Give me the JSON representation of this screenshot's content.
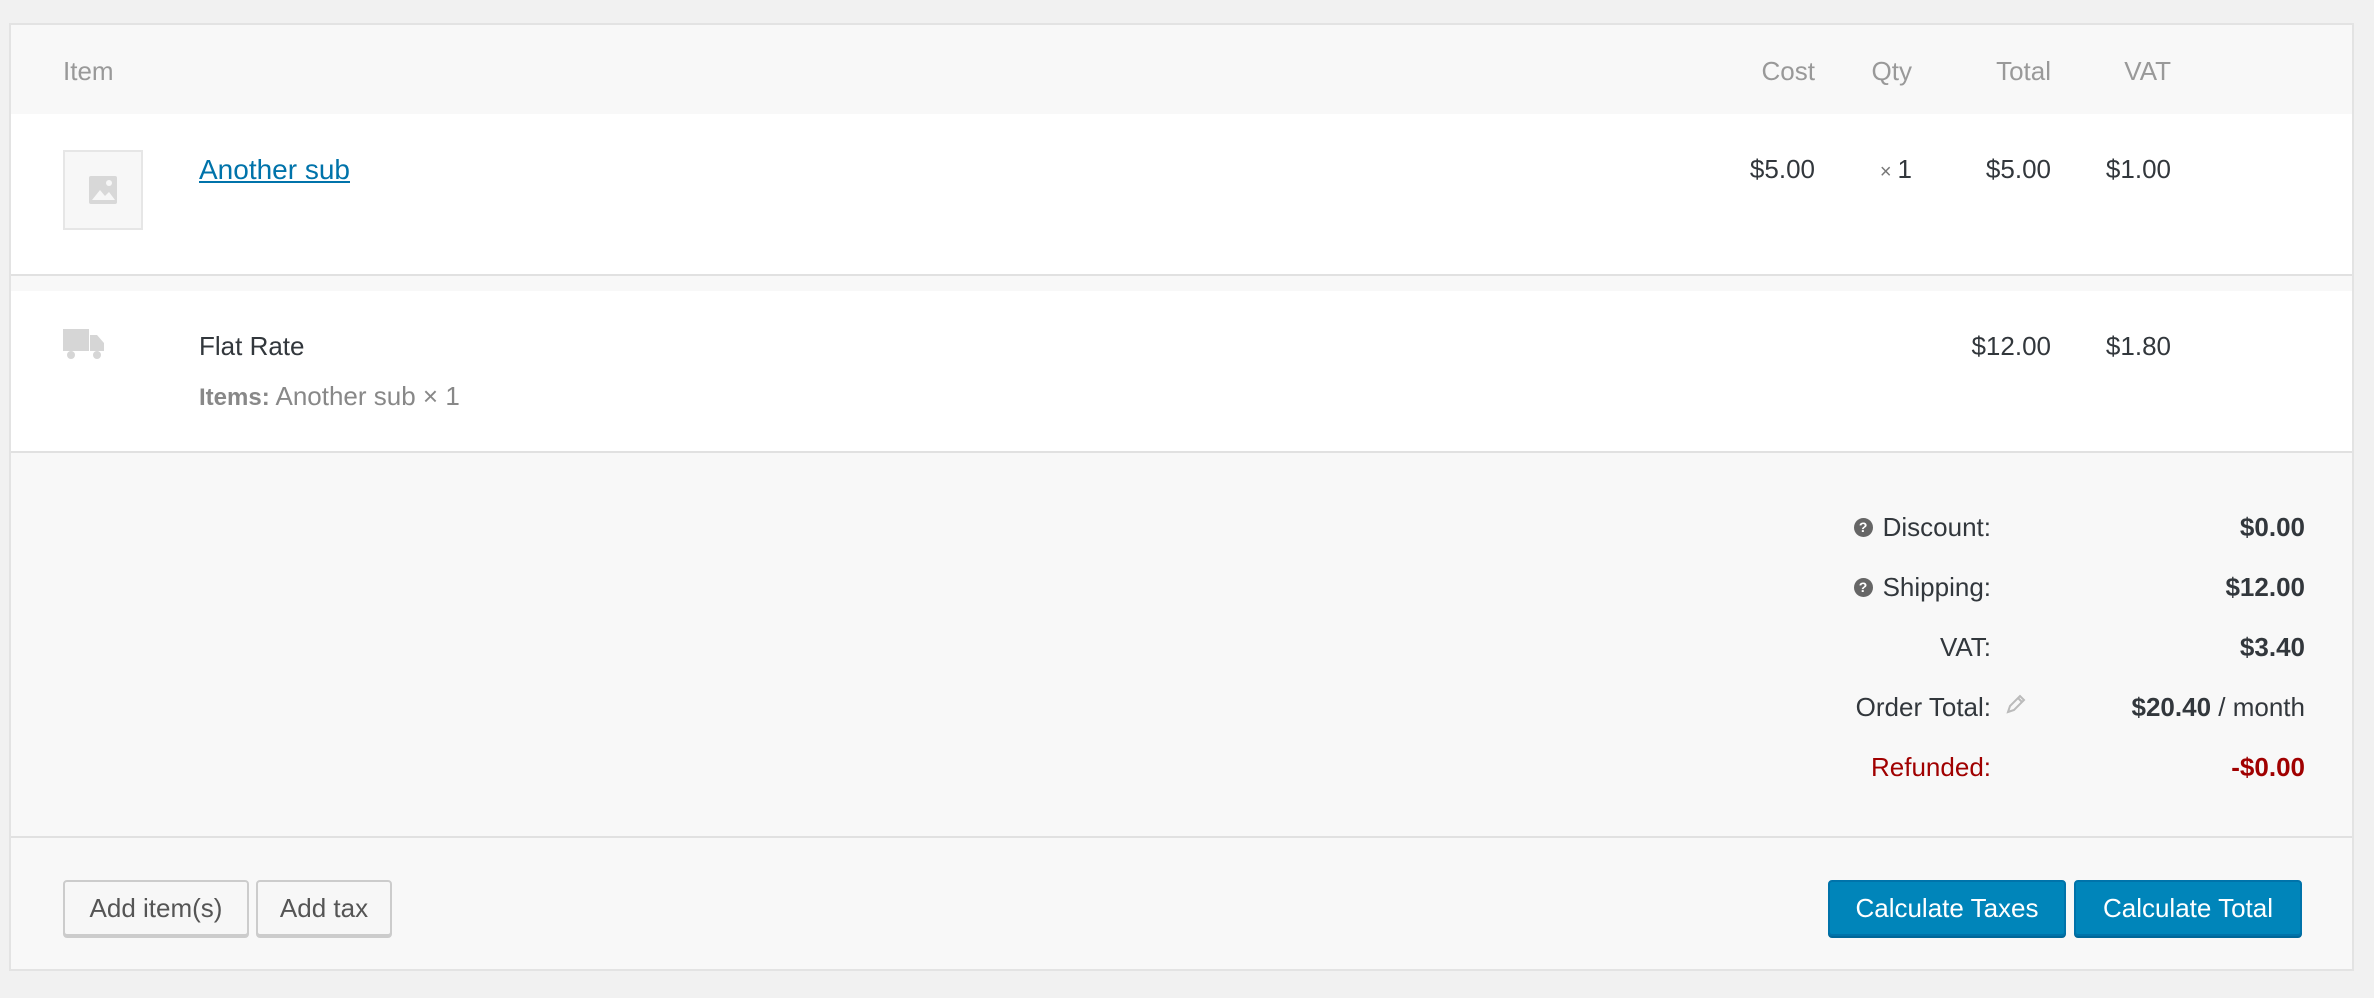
{
  "headers": {
    "item": "Item",
    "cost": "Cost",
    "qty": "Qty",
    "total": "Total",
    "vat": "VAT"
  },
  "line_item": {
    "name": "Another sub",
    "cost": "$5.00",
    "qty_prefix": "×",
    "qty": "1",
    "total": "$5.00",
    "vat": "$1.00"
  },
  "shipping_item": {
    "name": "Flat Rate",
    "items_label": "Items:",
    "items_value": "Another sub × 1",
    "total": "$12.00",
    "vat": "$1.80"
  },
  "totals": {
    "discount_label": "Discount:",
    "discount_value": "$0.00",
    "shipping_label": "Shipping:",
    "shipping_value": "$12.00",
    "vat_label": "VAT:",
    "vat_value": "$3.40",
    "order_total_label": "Order Total:",
    "order_total_value": "$20.40",
    "order_total_period": "/ month",
    "refunded_label": "Refunded:",
    "refunded_value": "-$0.00",
    "refund_color": "#a00000"
  },
  "buttons": {
    "add_items": "Add item(s)",
    "add_tax": "Add tax",
    "calculate_taxes": "Calculate Taxes",
    "calculate_total": "Calculate Total"
  },
  "icons": {
    "product_placeholder": "image-placeholder-icon",
    "shipping": "truck-icon",
    "help": "help-icon",
    "edit": "pencil-icon"
  }
}
